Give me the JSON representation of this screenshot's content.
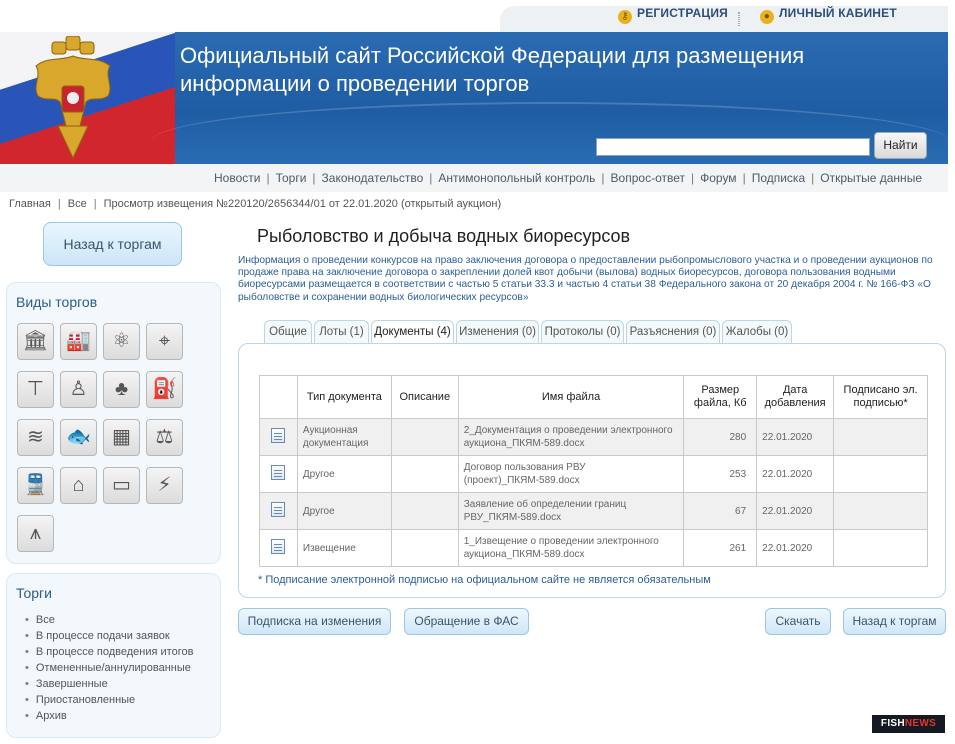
{
  "top_links": {
    "registration": "РЕГИСТРАЦИЯ",
    "cabinet": "ЛИЧНЫЙ КАБИНЕТ"
  },
  "banner": {
    "title": "Официальный сайт Российской Федерации для размещения информации о проведении торгов",
    "search_value": "",
    "search_button": "Найти"
  },
  "nav": {
    "items": [
      "Новости",
      "Торги",
      "Законодательство",
      "Антимонопольный контроль",
      "Вопрос-ответ",
      "Форум",
      "Подписка",
      "Открытые данные"
    ]
  },
  "breadcrumbs": [
    "Главная",
    "Все",
    "Просмотр извещения №220120/2656344/01 от 22.01.2020 (открытый аукцион)"
  ],
  "sidebar": {
    "back_button": "Назад к торгам",
    "types_title": "Виды торгов",
    "type_icons": [
      {
        "name": "government-building-icon",
        "glyph": "🏛"
      },
      {
        "name": "factory-icon",
        "glyph": "🏭"
      },
      {
        "name": "atom-icon",
        "glyph": "⚛"
      },
      {
        "name": "survey-tripod-icon",
        "glyph": "⌖"
      },
      {
        "name": "crane-icon",
        "glyph": "⊤"
      },
      {
        "name": "hunter-icon",
        "glyph": "♙"
      },
      {
        "name": "forest-icon",
        "glyph": "♣"
      },
      {
        "name": "oil-pump-icon",
        "glyph": "⛽"
      },
      {
        "name": "water-icon",
        "glyph": "≋"
      },
      {
        "name": "fish-icon",
        "glyph": "🐟"
      },
      {
        "name": "office-building-icon",
        "glyph": "▦"
      },
      {
        "name": "scales-icon",
        "glyph": "⚖"
      },
      {
        "name": "train-icon",
        "glyph": "🚆"
      },
      {
        "name": "house-icon",
        "glyph": "⌂"
      },
      {
        "name": "billboard-icon",
        "glyph": "▭"
      },
      {
        "name": "power-line-icon",
        "glyph": "⚡"
      },
      {
        "name": "radio-tower-icon",
        "glyph": "⩚"
      }
    ],
    "auctions_title": "Торги",
    "auctions_items": [
      "Все",
      "В процессе подачи заявок",
      "В процессе подведения итогов",
      "Отмененные/аннулированные",
      "Завершенные",
      "Приостановленные",
      "Архив"
    ]
  },
  "main": {
    "title": "Рыболовство и добыча водных биоресурсов",
    "intro": "Информация о проведении конкурсов на право заключения договора о предоставлении рыбопромыслового участка и о проведении аукционов по продаже права на заключение договора о закреплении долей квот добычи (вылова) водных биоресурсов, договора пользования водными биоресурсами размещается в соответствии с частью 5 статьи 33.3 и частью 4 статьи 38 Федерального закона от 20 декабря 2004 г. № 166-ФЗ «О рыболовстве и сохранении водных биологических ресурсов»",
    "tabs": [
      "Общие",
      "Лоты (1)",
      "Документы (4)",
      "Изменения (0)",
      "Протоколы (0)",
      "Разъяснения (0)",
      "Жалобы (0)"
    ],
    "active_tab": "Документы (4)",
    "table": {
      "headers": [
        "",
        "Тип документа",
        "Описание",
        "Имя файла",
        "Размер файла, Кб",
        "Дата добавления",
        "Подписано эл. подписью*"
      ],
      "rows": [
        {
          "type": "Аукционная документация",
          "description": "",
          "file": "2_Документация о проведении электронного аукциона_ПКЯМ-589.docx",
          "size": "280",
          "date": "22.01.2020",
          "signed": ""
        },
        {
          "type": "Другое",
          "description": "",
          "file": "Договор пользования РВУ (проект)_ПКЯМ-589.docx",
          "size": "253",
          "date": "22.01.2020",
          "signed": ""
        },
        {
          "type": "Другое",
          "description": "",
          "file": "Заявление об определении границ РВУ_ПКЯМ-589.docx",
          "size": "67",
          "date": "22.01.2020",
          "signed": ""
        },
        {
          "type": "Извещение",
          "description": "",
          "file": "1_Извещение о проведении электронного аукциона_ПКЯМ-589.docx",
          "size": "261",
          "date": "22.01.2020",
          "signed": ""
        }
      ]
    },
    "footnote": "* Подписание электронной подписью на официальном сайте не является обязательным",
    "buttons": {
      "subscribe": "Подписка на изменения",
      "fas": "Обращение в ФАС",
      "download": "Скачать",
      "back": "Назад к торгам"
    }
  },
  "watermark": {
    "part1": "FISH",
    "part2": "NEWS"
  }
}
